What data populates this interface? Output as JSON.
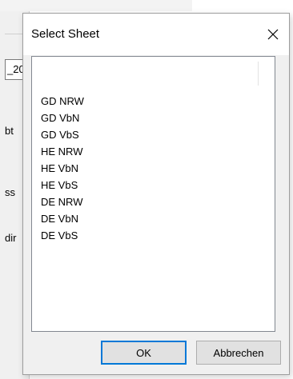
{
  "background_window": {
    "field_value": "_20",
    "labels": [
      "bt",
      "ss",
      "dir"
    ]
  },
  "dialog": {
    "title": "Select Sheet",
    "sheets": [
      "GD NRW",
      "GD VbN",
      "GD VbS",
      "HE NRW",
      "HE VbN",
      "HE VbS",
      "DE NRW",
      "DE VbN",
      "DE VbS"
    ],
    "ok_label": "OK",
    "cancel_label": "Abbrechen",
    "accent_color": "#0078d7"
  }
}
